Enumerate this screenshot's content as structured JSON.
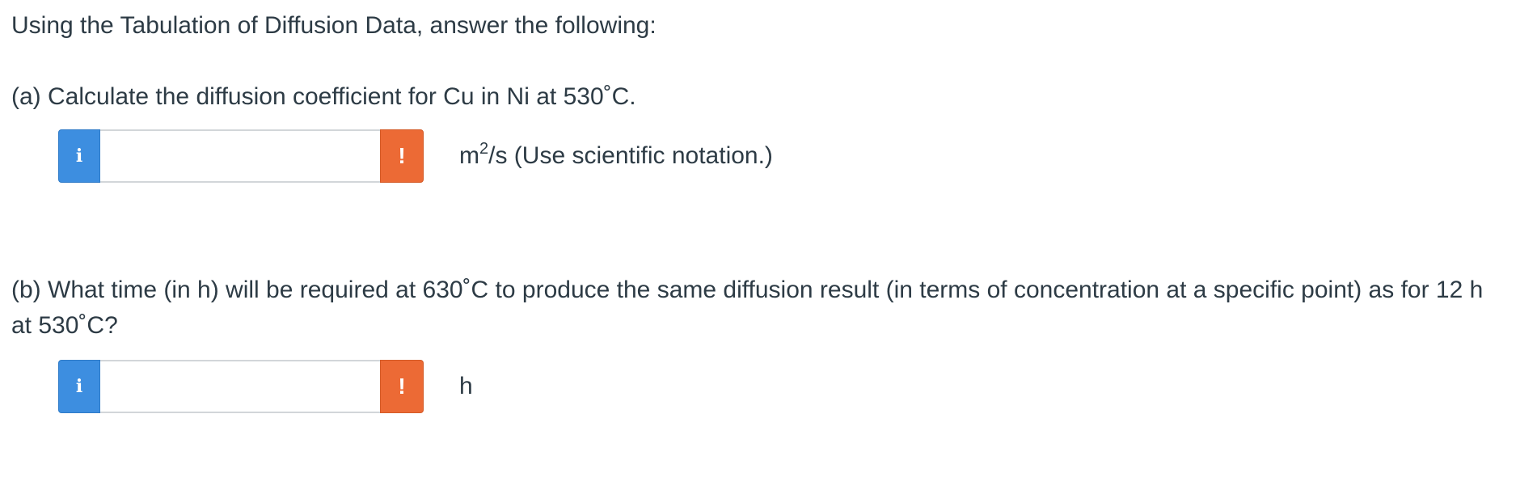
{
  "intro": "Using the Tabulation of Diffusion Data, answer the following:",
  "part_a": {
    "question": "(a) Calculate the diffusion coefficient for Cu in Ni at 530˚C.",
    "input_value": "",
    "info_icon": "i",
    "warning_icon": "!",
    "unit_base": "m",
    "unit_exponent": "2",
    "unit_rest": "/s (Use scientific notation.)"
  },
  "part_b": {
    "question": "(b) What time (in h) will be required at 630˚C to produce the same diffusion result (in terms of concentration at a specific point) as for 12 h at 530˚C?",
    "input_value": "",
    "info_icon": "i",
    "warning_icon": "!",
    "unit": "h"
  },
  "colors": {
    "info_button": "#3d8ee0",
    "warning_button": "#ec6a35",
    "text": "#2d3b45",
    "input_border": "#d2d6d9"
  },
  "icons": {
    "info": "info-icon",
    "warning": "warning-icon"
  }
}
